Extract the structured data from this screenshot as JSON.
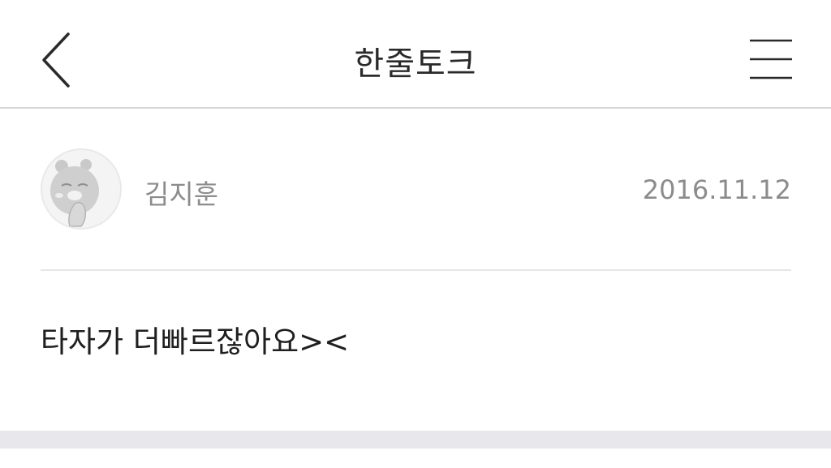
{
  "header": {
    "title": "한줄토크",
    "back_icon": "chevron-left-icon",
    "menu_icon": "hamburger-menu-icon"
  },
  "post": {
    "author": "김지훈",
    "date": "2016.11.12",
    "avatar_icon": "character-avatar-icon",
    "content": "타자가 더빠르잖아요><"
  },
  "colors": {
    "background": "#ffffff",
    "divider": "#e6e6e6",
    "meta_text": "#8c8c8c",
    "footer_band": "#e8e8ec"
  }
}
